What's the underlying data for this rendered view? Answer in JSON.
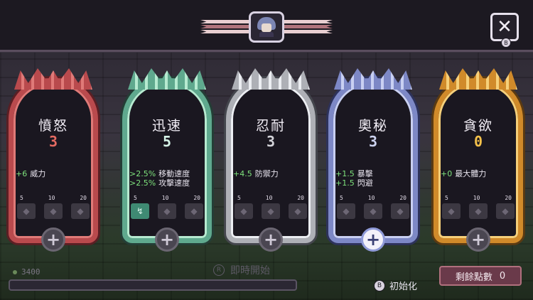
{
  "header": {
    "portrait_icon": "character-portrait-icon",
    "close_label": "✕",
    "close_hint": "B"
  },
  "cards": [
    {
      "title": "憤怒",
      "level": "3",
      "bonuses": [
        {
          "value": "+6",
          "name": "威力"
        }
      ],
      "ticks": [
        "5",
        "10",
        "20"
      ],
      "active_slots": 0,
      "frame_color": "#b94a4d"
    },
    {
      "title": "迅速",
      "level": "5",
      "bonuses": [
        {
          "value": ">2.5%",
          "name": "移動速度"
        },
        {
          "value": ">2.5%",
          "name": "攻擊速度"
        }
      ],
      "ticks": [
        "5",
        "10",
        "20"
      ],
      "active_slots": 1,
      "frame_color": "#5fa98e"
    },
    {
      "title": "忍耐",
      "level": "3",
      "bonuses": [
        {
          "value": "+4.5",
          "name": "防禦力"
        }
      ],
      "ticks": [
        "5",
        "10",
        "20"
      ],
      "active_slots": 0,
      "frame_color": "#aeb0b6"
    },
    {
      "title": "奧秘",
      "level": "3",
      "bonuses": [
        {
          "value": "+1.5",
          "name": "暴擊"
        },
        {
          "value": "+1.5",
          "name": "閃避"
        }
      ],
      "ticks": [
        "5",
        "10",
        "20"
      ],
      "active_slots": 0,
      "frame_color": "#7d88c6",
      "selected": true
    },
    {
      "title": "貪欲",
      "level": "0",
      "bonuses": [
        {
          "value": "+0",
          "name": "最大體力"
        }
      ],
      "ticks": [
        "5",
        "10",
        "20"
      ],
      "active_slots": 0,
      "frame_color": "#d08a2a"
    }
  ],
  "footer": {
    "gold": "3400",
    "progress_fraction": 0.0,
    "instant_start_hint": "R",
    "instant_start_label": "即時開始",
    "reset_hint": "B",
    "reset_label": "初始化",
    "points_label": "剩餘點數",
    "points_value": "0"
  }
}
